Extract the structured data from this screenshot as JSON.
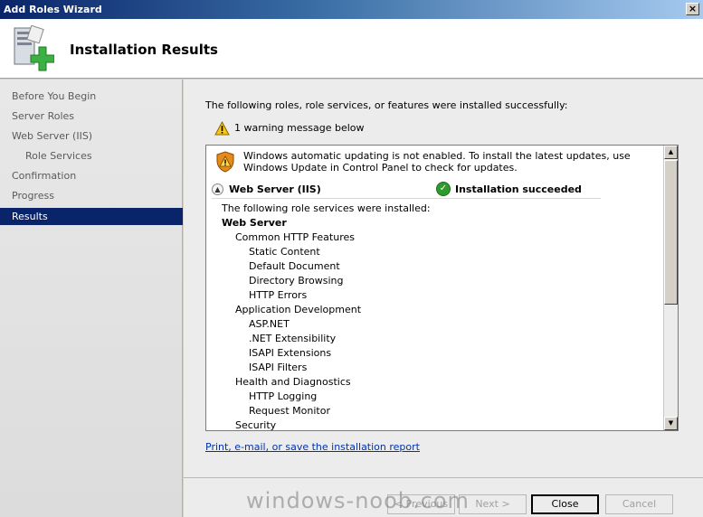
{
  "window": {
    "title": "Add Roles Wizard",
    "close_glyph": "×"
  },
  "header": {
    "title": "Installation Results",
    "icon": "server-add-icon"
  },
  "nav": {
    "items": [
      {
        "label": "Before You Begin"
      },
      {
        "label": "Server Roles"
      },
      {
        "label": "Web Server (IIS)"
      },
      {
        "label": "Role Services"
      },
      {
        "label": "Confirmation"
      },
      {
        "label": "Progress"
      },
      {
        "label": "Results"
      }
    ]
  },
  "content": {
    "intro": "The following roles, role services, or features were installed successfully:",
    "warning_count": "1 warning message below",
    "warning_message": "Windows automatic updating is not enabled. To install the latest updates, use Windows Update in Control Panel to check for updates.",
    "role_name": "Web Server (IIS)",
    "role_status": "Installation succeeded",
    "services_intro": "The following role services were installed:",
    "tree": [
      {
        "label": "Web Server"
      },
      {
        "label": "Common HTTP Features"
      },
      {
        "label": "Static Content"
      },
      {
        "label": "Default Document"
      },
      {
        "label": "Directory Browsing"
      },
      {
        "label": "HTTP Errors"
      },
      {
        "label": "Application Development"
      },
      {
        "label": "ASP.NET"
      },
      {
        "label": ".NET Extensibility"
      },
      {
        "label": "ISAPI Extensions"
      },
      {
        "label": "ISAPI Filters"
      },
      {
        "label": "Health and Diagnostics"
      },
      {
        "label": "HTTP Logging"
      },
      {
        "label": "Request Monitor"
      },
      {
        "label": "Security"
      }
    ],
    "report_link": "Print, e-mail, or save the installation report"
  },
  "buttons": {
    "previous": "< Previous",
    "next": "Next >",
    "close": "Close",
    "cancel": "Cancel"
  },
  "watermark": "windows-noob.com",
  "colors": {
    "selected_nav": "#0a246a",
    "link": "#0033aa",
    "success": "#2e9b2e"
  }
}
